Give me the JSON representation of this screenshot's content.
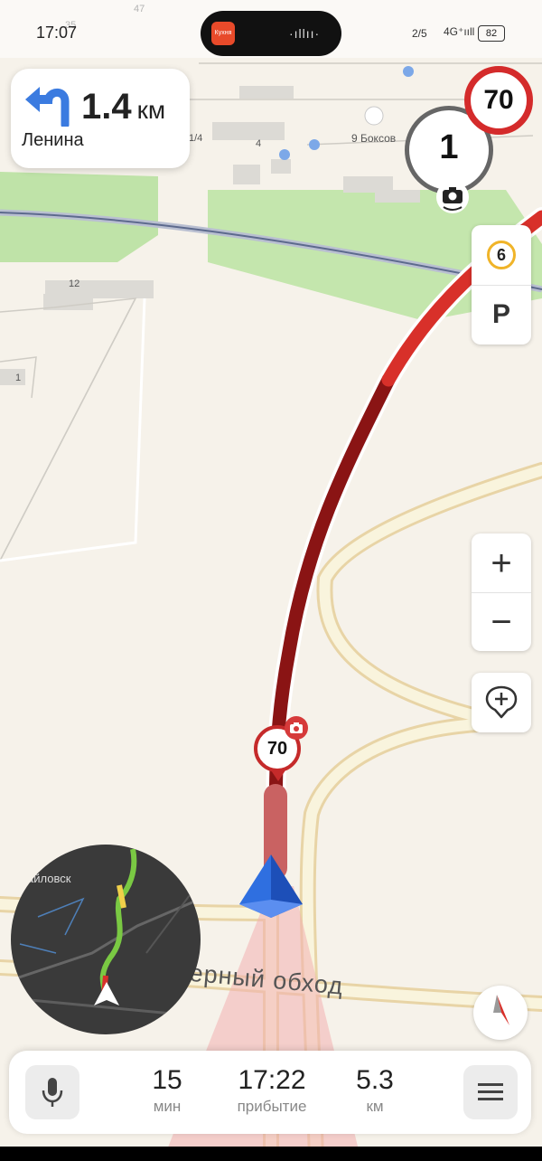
{
  "status_bar": {
    "time": "17:07",
    "app_badge": "Кухня",
    "waveform": "·ıllıı·",
    "network": "2/5",
    "signal": "4G⁺ııll",
    "battery": "82"
  },
  "navigation": {
    "turn_icon": "turn-left-arrow-icon",
    "distance_value": "1.4",
    "distance_unit": "км",
    "street": "Ленина"
  },
  "speed_limit": {
    "value": "70"
  },
  "camera_widget": {
    "value": "1",
    "icon": "speed-camera-icon"
  },
  "side_panel": {
    "traffic_score": "6",
    "parking_label": "P"
  },
  "zoom": {
    "in_label": "+",
    "out_label": "−"
  },
  "route": {
    "camera_limit": "70"
  },
  "map_labels": {
    "road_name": "Северный обход",
    "poi_name": "9 Боксов",
    "building_a": "12",
    "building_b": "1",
    "building_c": "4",
    "building_d": "1/4",
    "building_e": "47",
    "building_f": "35",
    "minimap_city": "айловск"
  },
  "bottom_bar": {
    "duration_value": "15",
    "duration_label": "мин",
    "arrival_value": "17:22",
    "arrival_label": "прибытие",
    "distance_value": "5.3",
    "distance_label": "км"
  },
  "colors": {
    "route_dark": "#8a1414",
    "route_red": "#d8302a",
    "arrow_blue": "#2f6fe0",
    "limit_red": "#d42b2b",
    "traffic_yellow": "#f0b429",
    "green_area": "#b8e0a0"
  }
}
